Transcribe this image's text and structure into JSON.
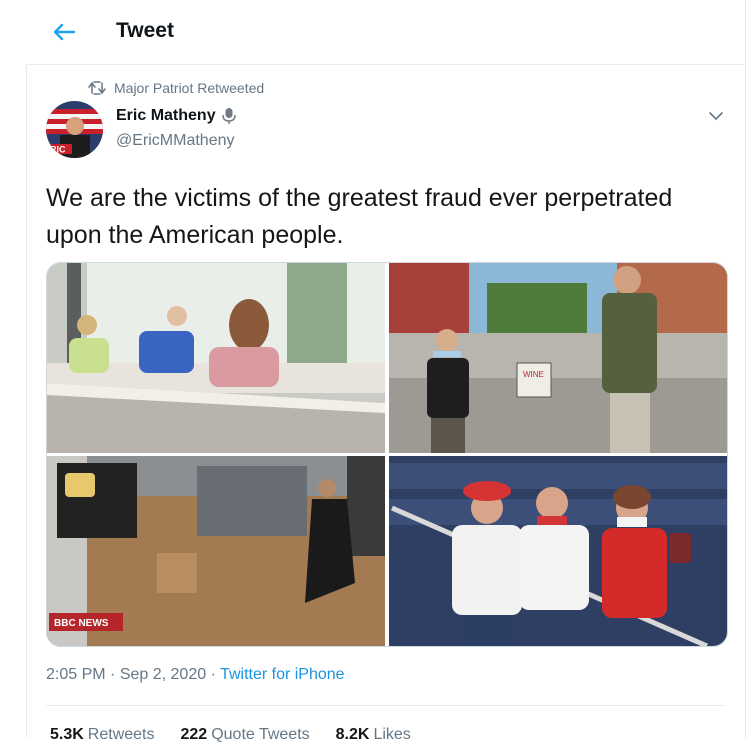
{
  "header": {
    "title": "Tweet"
  },
  "retweet": {
    "text": "Major Patriot Retweeted"
  },
  "author": {
    "name": "Eric Matheny",
    "handle": "@EricMMatheny",
    "avatar_label": "RIC"
  },
  "tweet": {
    "text": "We are the victims of the greatest fraud ever perpetrated upon the American people.",
    "sign_text": "WINE",
    "watermark": "BBC NEWS"
  },
  "meta": {
    "time": "2:05 PM",
    "sep": "·",
    "date": "Sep 2, 2020",
    "source": "Twitter for iPhone"
  },
  "stats": {
    "retweets_count": "5.3K",
    "retweets_label": "Retweets",
    "quotes_count": "222",
    "quotes_label": "Quote Tweets",
    "likes_count": "8.2K",
    "likes_label": "Likes"
  },
  "colors": {
    "accent": "#1da1f2",
    "link": "#1b95e0",
    "muted": "#657786"
  }
}
